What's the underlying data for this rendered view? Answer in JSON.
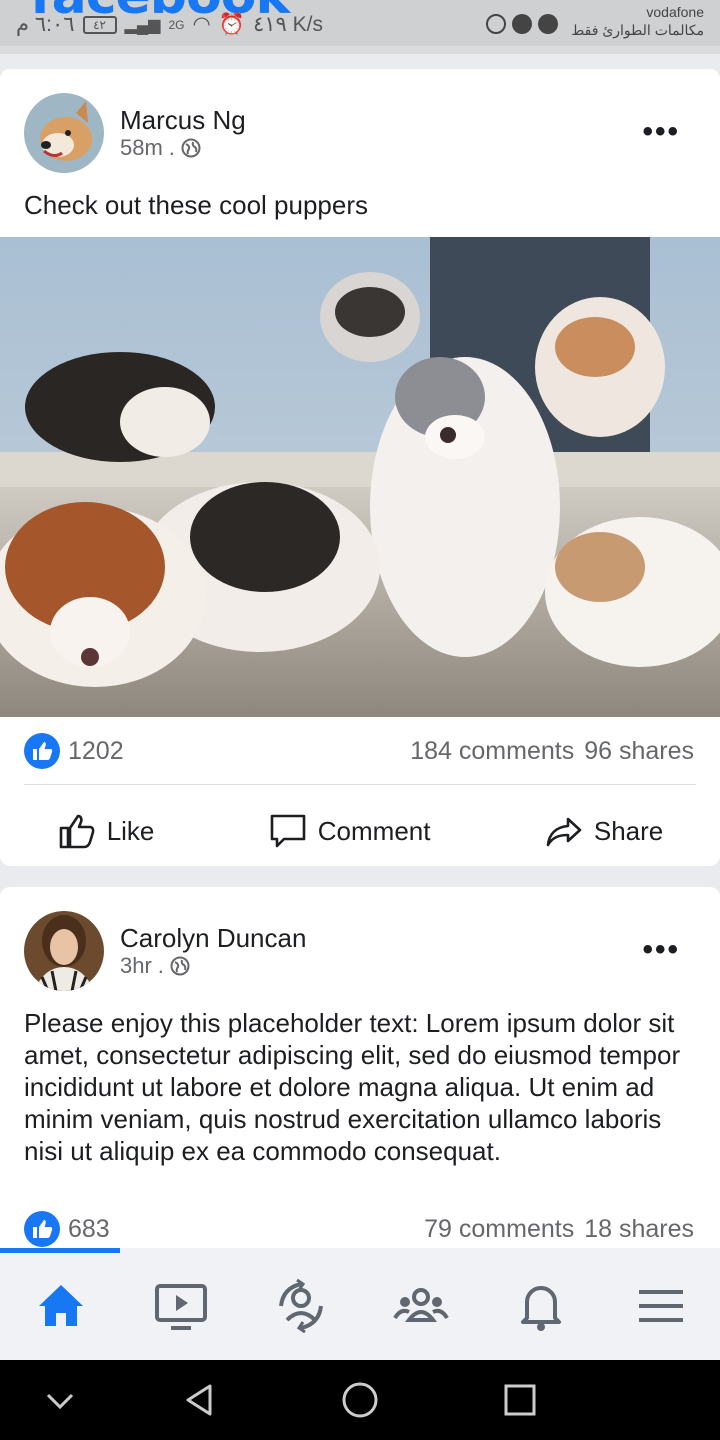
{
  "status_bar": {
    "time": "٦:٠٦ م",
    "battery": "٤٢",
    "network": "2G",
    "speed": "٤١٩ K/s",
    "carrier": "vodafone",
    "calls_note": "مكالمات الطوارئ فقط",
    "app_logo_peek": "facebook"
  },
  "posts": [
    {
      "author": "Marcus Ng",
      "time": "58m",
      "separator": " .",
      "text": "Check out these cool puppers",
      "like_count": "1202",
      "comments": "184 comments",
      "shares": "96 shares",
      "actions": {
        "like": "Like",
        "comment": "Comment",
        "share": "Share"
      }
    },
    {
      "author": "Carolyn Duncan",
      "time": "3hr",
      "separator": " .",
      "text": "Please enjoy this placeholder text: Lorem ipsum dolor sit amet, consectetur adipiscing elit, sed do eiusmod tempor incididunt ut labore et dolore magna aliqua. Ut enim ad minim veniam, quis nostrud exercitation ullamco laboris nisi ut aliquip ex ea commodo consequat.",
      "like_count": "683",
      "comments": "79 comments",
      "shares": "18 shares"
    }
  ],
  "tabs": [
    {
      "icon": "home-icon",
      "active": true
    },
    {
      "icon": "video-icon",
      "active": false
    },
    {
      "icon": "dating-icon",
      "active": false
    },
    {
      "icon": "groups-icon",
      "active": false
    },
    {
      "icon": "notifications-icon",
      "active": false
    },
    {
      "icon": "menu-icon",
      "active": false
    }
  ],
  "colors": {
    "accent": "#1877f2",
    "text": "#1c1e21",
    "muted": "#65676b"
  }
}
